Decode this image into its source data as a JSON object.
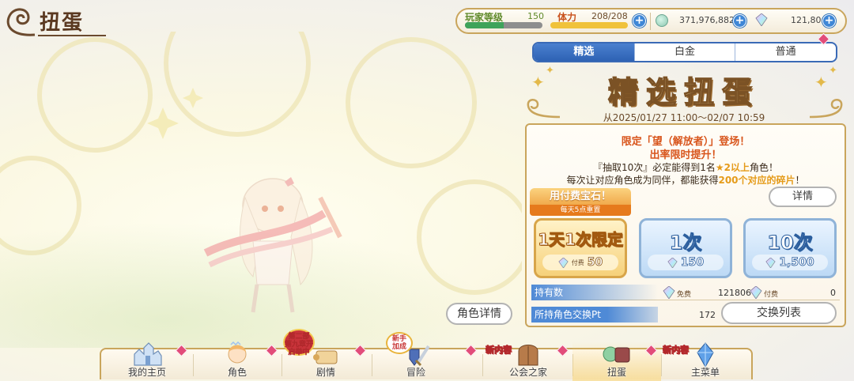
{
  "header": {
    "title": "扭蛋"
  },
  "status": {
    "level_label": "玩家等级",
    "level_value": "150",
    "level_progress": 0.5,
    "stamina_label": "体力",
    "stamina_value": "208/208",
    "stamina_progress": 1.0,
    "mana": "371,976,882",
    "gems": "121,806",
    "add_symbol": "+"
  },
  "tabs": [
    {
      "label": "精选",
      "active": true
    },
    {
      "label": "白金",
      "active": false
    },
    {
      "label": "普通",
      "active": false
    }
  ],
  "banner": {
    "title": "精选扭蛋",
    "date": "从2025/01/27 11:00～02/07 10:59"
  },
  "info": {
    "line1": "限定「望（解放者）」登场！",
    "line2": "出率限时提升！",
    "line3_pre": "『抽取10次』必定能得到1名",
    "line3_star": "★",
    "line3_hl": "2以上",
    "line3_post": "角色！",
    "line4_pre": "每次让对应角色成为同伴，都能获得",
    "line4_hl": "200个对应的碎片",
    "line4_post": "！"
  },
  "paid": {
    "label": "用付费宝石！",
    "sub": "每天5点重置"
  },
  "detail_button": "详情",
  "draws": [
    {
      "label": "1天1次限定",
      "tag": "付费",
      "cost": "50"
    },
    {
      "label": "1次",
      "cost": "150"
    },
    {
      "label": "10次",
      "cost": "1,500"
    }
  ],
  "holdings": {
    "label": "持有数",
    "free_tag": "免费",
    "free_value": "121806",
    "paid_tag": "付费",
    "paid_value": "0"
  },
  "exchange": {
    "label": "所持角色交换Pt",
    "value": "172",
    "button": "交换列表"
  },
  "character_detail_button": "角色详情",
  "nav": [
    {
      "label": "我的主页"
    },
    {
      "label": "角色"
    },
    {
      "label": "剧情",
      "badge_line1": "第二部",
      "badge_line2": "第九章开",
      "badge_line3": "启举中"
    },
    {
      "label": "冒险",
      "badge_line1": "新手",
      "badge_line2": "加成"
    },
    {
      "label": "公会之家",
      "badge": "新内容"
    },
    {
      "label": "扭蛋",
      "active": true
    },
    {
      "label": "主菜单",
      "badge": "新内容"
    }
  ],
  "colors": {
    "accent_blue": "#2e62b4",
    "gold_border": "#c9a55c",
    "highlight_orange": "#d8551c",
    "pink_diamond": "#e24c7a"
  }
}
